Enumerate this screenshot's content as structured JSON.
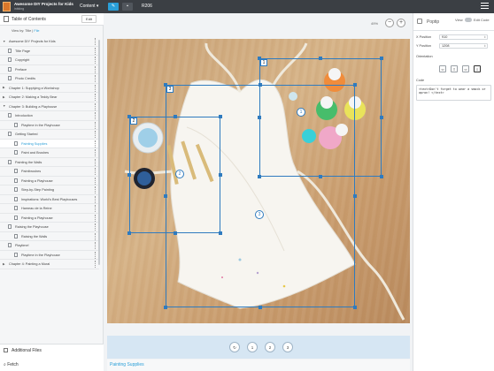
{
  "topbar": {
    "book_title": "Awesome DIY Projects for Kids",
    "book_sub": "inbking",
    "content_menu": "Content ▾",
    "code": "R206",
    "edit_icon": "pencil-icon",
    "preview_icon": "chat-icon",
    "menu_icon": "hamburger-icon"
  },
  "sidebar": {
    "title": "Table of Contents",
    "edit_label": "Edit",
    "view_by": "View by: Title |",
    "view_by_link": "File",
    "items": [
      {
        "label": "Awesome DIY Projects for Kids",
        "level": 0,
        "arrow": "▼"
      },
      {
        "label": "Title Page",
        "level": 1
      },
      {
        "label": "Copyright",
        "level": 1
      },
      {
        "label": "Preface",
        "level": 1
      },
      {
        "label": "Photo Credits",
        "level": 1
      },
      {
        "label": "Chapter 1: Supplying a Workshop",
        "level": 0,
        "arrow": "▶"
      },
      {
        "label": "Chapter 2: Making a Teddy Bear",
        "level": 0,
        "arrow": "▶"
      },
      {
        "label": "Chapter 3: Building a Playhouse",
        "level": 0,
        "arrow": "▼"
      },
      {
        "label": "Introduction",
        "level": 1
      },
      {
        "label": "Playtime in the Playhouse",
        "level": 2
      },
      {
        "label": "Getting Started",
        "level": 1
      },
      {
        "label": "Painting Supplies",
        "level": 2,
        "active": true
      },
      {
        "label": "Paint and Brushes",
        "level": 2
      },
      {
        "label": "Painting the Walls",
        "level": 1
      },
      {
        "label": "Paintbrushes",
        "level": 2
      },
      {
        "label": "Painting a Playhouse",
        "level": 2
      },
      {
        "label": "Step-by-Step Painting",
        "level": 2
      },
      {
        "label": "Inspirations: World's Best Playhouses",
        "level": 2
      },
      {
        "label": "Hameau de la Reine",
        "level": 2
      },
      {
        "label": "Painting a Playhouse",
        "level": 2
      },
      {
        "label": "Raising the Playhouse",
        "level": 1
      },
      {
        "label": "Raising the Walls",
        "level": 2
      },
      {
        "label": "Playtime!",
        "level": 1
      },
      {
        "label": "Playtime in the Playhouse",
        "level": 2
      },
      {
        "label": "Chapter 4: Painting a Mural",
        "level": 0,
        "arrow": "▶"
      }
    ],
    "additional_files": "Additional Files",
    "fetch": "Fetch"
  },
  "canvas": {
    "zoom": "49%",
    "zoom_out": "−",
    "zoom_in": "+",
    "hotspots": [
      "1",
      "2",
      "3"
    ],
    "markers": [
      "1",
      "2",
      "3"
    ],
    "nav_buttons": [
      "↻",
      "1",
      "2",
      "3"
    ],
    "caption": "Painting Supplies"
  },
  "inspector": {
    "title": "Poptip",
    "view_label": "View",
    "edit_label": "Edit Code",
    "x_label": "X Position",
    "x_value": "910",
    "y_label": "Y Position",
    "y_value": "1208",
    "orientation_label": "Orientation",
    "orientations": [
      "⇦",
      "⇧",
      "⇨",
      "⇩"
    ],
    "code_label": "Code",
    "code_value": "<text>Don't forget to wear a smock or apron! </text>"
  }
}
